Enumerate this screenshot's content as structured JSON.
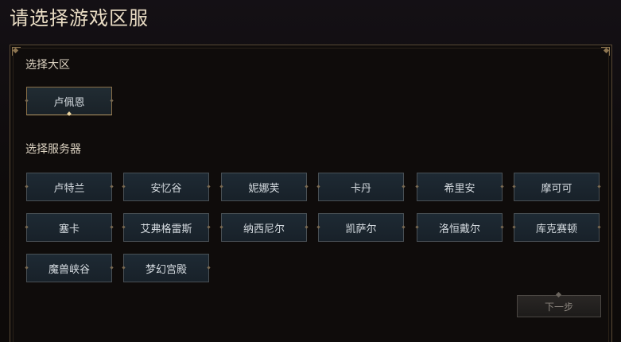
{
  "page": {
    "title": "请选择游戏区服"
  },
  "region_section": {
    "label": "选择大区",
    "regions": [
      {
        "label": "卢佩恩",
        "selected": true
      }
    ]
  },
  "server_section": {
    "label": "选择服务器",
    "servers": [
      {
        "label": "卢特兰"
      },
      {
        "label": "安忆谷"
      },
      {
        "label": "妮娜芙"
      },
      {
        "label": "卡丹"
      },
      {
        "label": "希里安"
      },
      {
        "label": "摩可可"
      },
      {
        "label": "塞卡"
      },
      {
        "label": "艾弗格雷斯"
      },
      {
        "label": "纳西尼尔"
      },
      {
        "label": "凯萨尔"
      },
      {
        "label": "洛恒戴尔"
      },
      {
        "label": "库克赛顿"
      },
      {
        "label": "魔兽峡谷"
      },
      {
        "label": "梦幻宫殿"
      }
    ]
  },
  "actions": {
    "next_label": "下一步",
    "next_enabled": false
  },
  "colors": {
    "title": "#e9dcc4",
    "tile_bg": "#1b252d",
    "tile_border": "#495055",
    "selected_accent": "#b89a64",
    "frame_border": "#5a4a35"
  }
}
